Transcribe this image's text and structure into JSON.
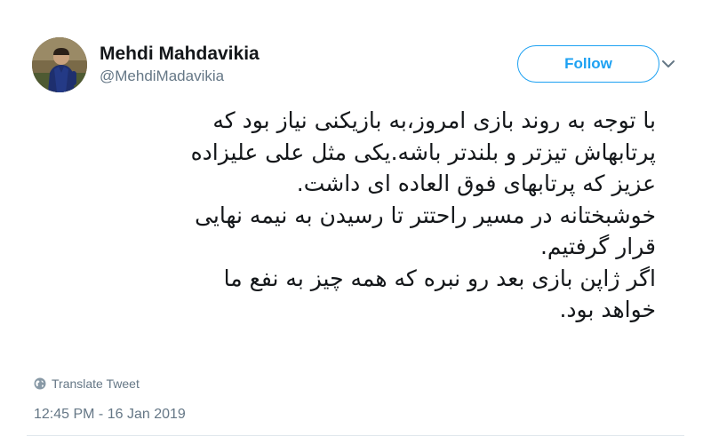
{
  "author": {
    "display_name": "Mehdi Mahdavikia",
    "handle": "@MehdiMadavikia"
  },
  "actions": {
    "follow_label": "Follow",
    "more_icon": "chevron-down-icon",
    "translate_icon": "globe-icon",
    "translate_label": "Translate Tweet"
  },
  "tweet": {
    "lines": [
      "با توجه به روند بازی امروز،به بازیکنی نیاز بود که",
      "پرتابهاش تیزتر و بلندتر باشه.یکی مثل علی علیزاده",
      "عزیز که پرتابهای فوق العاده ای داشت.",
      "خوشبختانه در مسیر راحتتر تا رسیدن به نیمه نهایی",
      "قرار گرفتیم.",
      "اگر ژاپن بازی بعد رو نبره که همه چیز به نفع ما",
      "خواهد بود."
    ],
    "timestamp": "12:45 PM - 16 Jan 2019"
  },
  "colors": {
    "accent": "#1da1f2",
    "secondary_text": "#657786",
    "primary_text": "#14171a"
  }
}
